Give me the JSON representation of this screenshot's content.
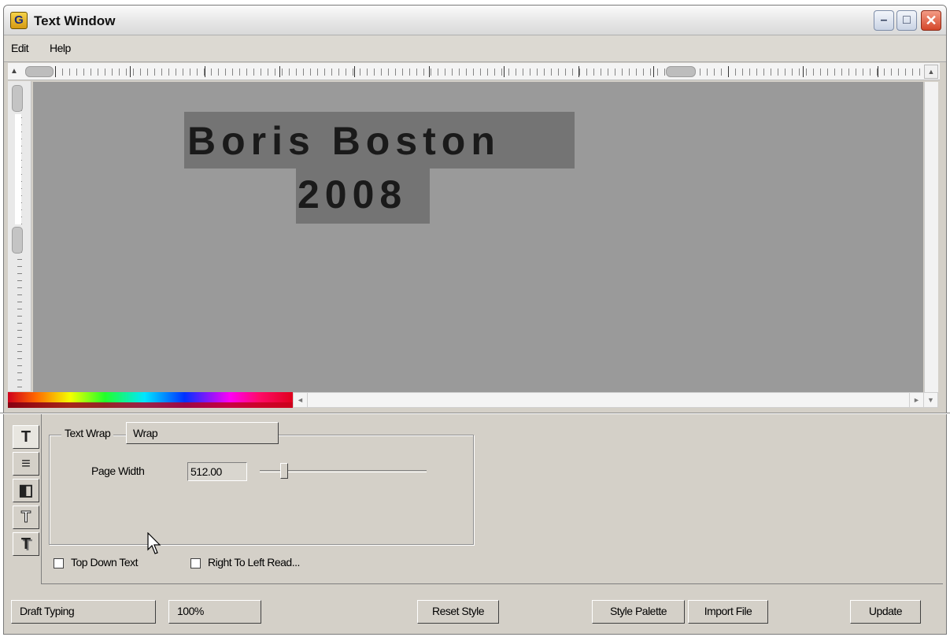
{
  "window": {
    "title": "Text Window",
    "app_icon_letter": "G",
    "minimize_glyph": "–",
    "maximize_glyph": "□",
    "close_glyph": "✕"
  },
  "menu": {
    "edit": "Edit",
    "help": "Help"
  },
  "canvas": {
    "line1": "Boris Boston",
    "line2": "2008",
    "background_color": "#9a9a9a",
    "highlight_color": "#747474"
  },
  "side_tools": [
    {
      "icon": "text-icon",
      "glyph": "T"
    },
    {
      "icon": "paragraph-icon",
      "glyph": "≡"
    },
    {
      "icon": "fill-icon",
      "glyph": "◧"
    },
    {
      "icon": "outline-text-icon",
      "glyph": "T"
    },
    {
      "icon": "shadow-text-icon",
      "glyph": "T"
    }
  ],
  "text_wrap": {
    "label": "Text Wrap",
    "value": "Wrap"
  },
  "page_width": {
    "label": "Page Width",
    "value": "512.00",
    "slider_level": 0.15
  },
  "checkboxes": {
    "top_down": {
      "label": "Top Down Text",
      "checked": false
    },
    "rtl": {
      "label": "Right To Left Read...",
      "checked": false
    }
  },
  "buttons": {
    "draft": "Draft Typing",
    "zoom": "100%",
    "reset": "Reset Style",
    "palette": "Style Palette",
    "import": "Import File",
    "update": "Update"
  },
  "scroll_glyphs": {
    "up": "▲",
    "left": "◄",
    "right": "►",
    "down": "▼"
  }
}
